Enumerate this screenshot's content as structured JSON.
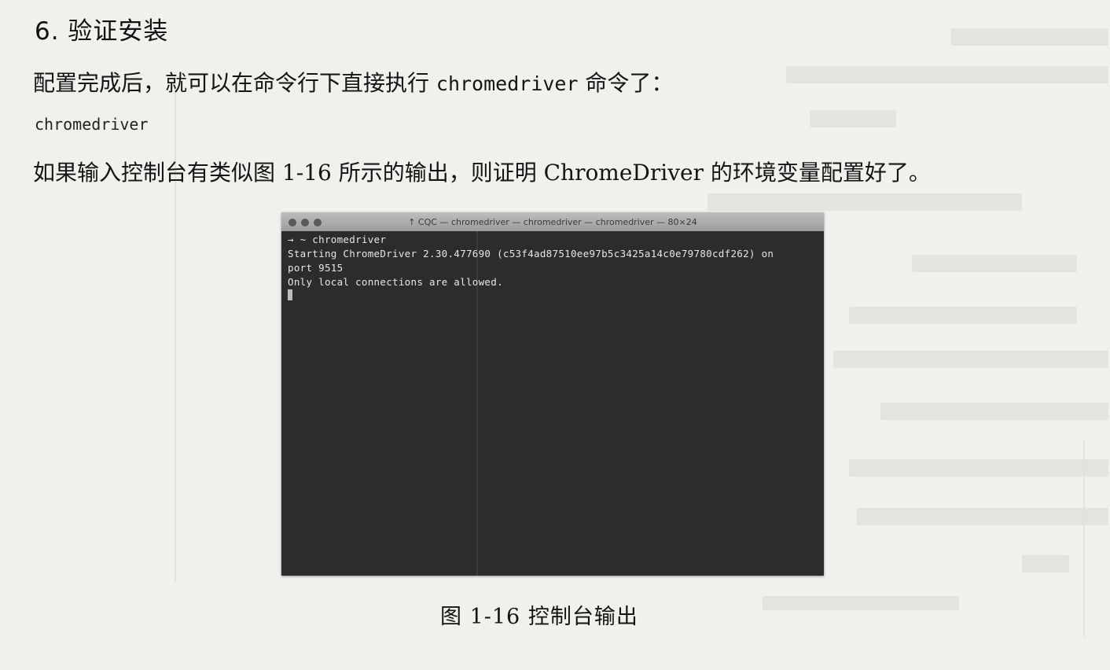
{
  "section": {
    "heading": "6. 验证安装",
    "para1_before": "配置完成后，就可以在命令行下直接执行 ",
    "para1_code": "chromedriver",
    "para1_after": " 命令了：",
    "code_line": "chromedriver",
    "para2": "如果输入控制台有类似图 1-16 所示的输出，则证明 ChromeDriver 的环境变量配置好了。"
  },
  "terminal": {
    "title": "↑ CQC — chromedriver — chromedriver — chromedriver — 80×24",
    "lines": [
      "→  ~ chromedriver",
      "Starting ChromeDriver 2.30.477690 (c53f4ad87510ee97b5c3425a14c0e79780cdf262) on",
      "port 9515",
      "Only local connections are allowed."
    ]
  },
  "figure": {
    "caption": "图 1-16   控制台输出"
  }
}
